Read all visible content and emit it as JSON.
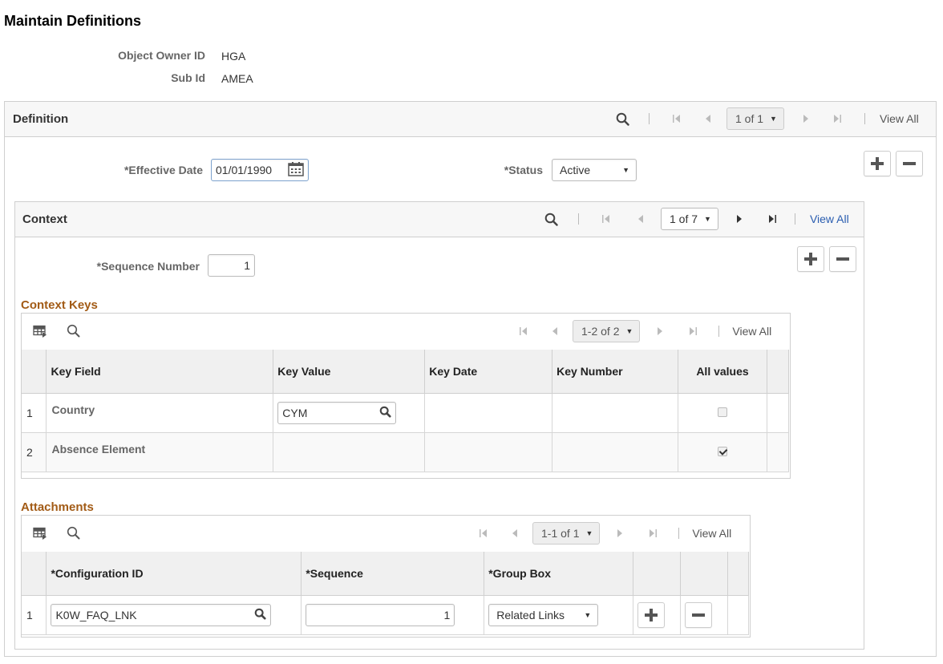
{
  "page": {
    "title": "Maintain Definitions"
  },
  "header_fields": [
    {
      "label": "Object Owner ID",
      "value": "HGA"
    },
    {
      "label": "Sub Id",
      "value": "AMEA"
    }
  ],
  "definition": {
    "title": "Definition",
    "pager": "1 of 1",
    "view_all": "View All",
    "effective_date_label": "*Effective Date",
    "effective_date_value": "01/01/1990",
    "status_label": "*Status",
    "status_value": "Active"
  },
  "context": {
    "title": "Context",
    "pager": "1 of 7",
    "view_all": "View All",
    "sequence_label": "*Sequence Number",
    "sequence_value": "1"
  },
  "context_keys": {
    "title": "Context Keys",
    "pager": "1-2 of 2",
    "view_all": "View All",
    "columns": [
      "Key Field",
      "Key Value",
      "Key Date",
      "Key Number",
      "All values"
    ],
    "rows": [
      {
        "num": "1",
        "key_field": "Country",
        "key_value": "CYM",
        "key_date": "",
        "key_number": "",
        "all_values": false
      },
      {
        "num": "2",
        "key_field": "Absence Element",
        "key_value": "",
        "key_date": "",
        "key_number": "",
        "all_values": true
      }
    ]
  },
  "attachments": {
    "title": "Attachments",
    "pager": "1-1 of 1",
    "view_all": "View All",
    "columns": [
      "*Configuration ID",
      "*Sequence",
      "*Group Box"
    ],
    "rows": [
      {
        "num": "1",
        "configuration_id": "K0W_FAQ_LNK",
        "sequence": "1",
        "group_box": "Related Links"
      }
    ]
  }
}
